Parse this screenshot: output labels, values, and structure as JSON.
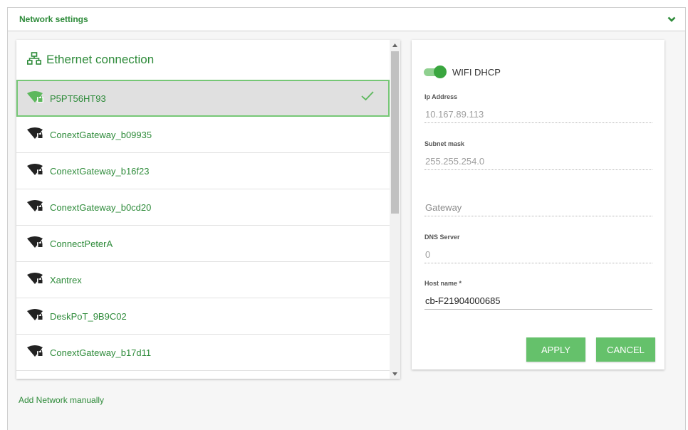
{
  "header": {
    "title": "Network settings",
    "toggle_icon": "chevron-down-icon"
  },
  "list": {
    "title": "Ethernet connection",
    "title_icon": "network-icon",
    "networks": [
      {
        "name": "P5PT56HT93",
        "selected": true,
        "connected": true
      },
      {
        "name": "ConextGateway_b09935",
        "selected": false
      },
      {
        "name": "ConextGateway_b16f23",
        "selected": false
      },
      {
        "name": "ConextGateway_b0cd20",
        "selected": false
      },
      {
        "name": "ConnectPeterA",
        "selected": false
      },
      {
        "name": "Xantrex",
        "selected": false
      },
      {
        "name": "DeskPoT_9B9C02",
        "selected": false
      },
      {
        "name": "ConextGateway_b17d11",
        "selected": false
      }
    ]
  },
  "add_network_label": "Add Network manually",
  "form": {
    "dhcp_label": "WIFI DHCP",
    "dhcp_on": true,
    "ip": {
      "label": "Ip Address",
      "value": "10.167.89.113"
    },
    "subnet": {
      "label": "Subnet mask",
      "value": "255.255.254.0"
    },
    "gateway": {
      "placeholder": "Gateway"
    },
    "dns": {
      "label": "DNS Server",
      "value": "0"
    },
    "host": {
      "label": "Host name *",
      "value": "cb-F21904000685"
    },
    "apply_label": "APPLY",
    "cancel_label": "CANCEL"
  },
  "colors": {
    "accent": "#2e8b3a",
    "button": "#65c16b",
    "selected_border": "#76c776"
  }
}
